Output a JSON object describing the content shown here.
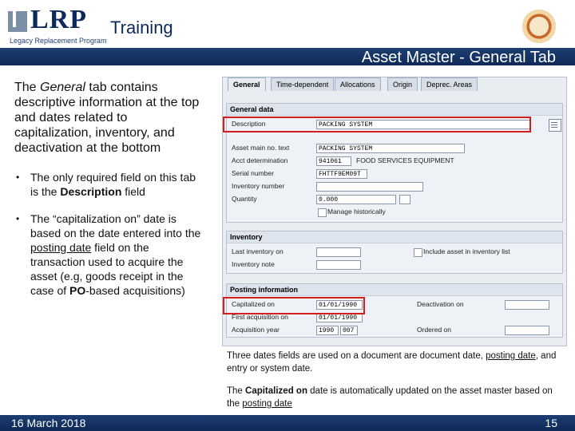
{
  "header": {
    "logo": "LRP",
    "logo_sub": "Legacy Replacement Program",
    "brand_title": "Training",
    "slide_title": "Asset Master - General Tab"
  },
  "left": {
    "intro_prefix": "The ",
    "intro_emph": "General",
    "intro_rest": " tab contains descriptive information at the top and dates related to capitalization, inventory, and deactivation at the bottom",
    "bullet1_prefix": "The only required field on this tab is the ",
    "bullet1_bold": "Description",
    "bullet1_suffix": " field",
    "bullet2_a": "The “capitalization on” date is based on the date entered into the ",
    "bullet2_link": "posting date",
    "bullet2_b": " field on the transaction used to acquire the asset (e.g, goods receipt in the case of ",
    "bullet2_bold": "PO",
    "bullet2_c": "-based acquisitions)"
  },
  "sap": {
    "tabs": [
      "General",
      "Time-dependent",
      "Allocations",
      "Origin",
      "Deprec. Areas"
    ],
    "general_data": {
      "title": "General data",
      "description_label": "Description",
      "description_value": "PACKING SYSTEM",
      "main_no_label": "Asset main no. text",
      "main_no_value": "PACKING SYSTEM",
      "acct_label": "Acct determination",
      "acct_value": "941061",
      "acct_text": "FOOD SERVICES EQUIPMENT",
      "serial_label": "Serial number",
      "serial_value": "FHTTF9EM09T",
      "inventory_number_label": "Inventory number",
      "quantity_label": "Quantity",
      "quantity_value": "0.000",
      "manage_hist_label": "Manage historically"
    },
    "inventory": {
      "title": "Inventory",
      "last_inv_label": "Last inventory on",
      "include_label": "Include asset in inventory list",
      "note_label": "Inventory note"
    },
    "posting": {
      "title": "Posting information",
      "cap_label": "Capitalized on",
      "cap_value": "01/01/1990",
      "first_acq_label": "First acquisition on",
      "first_acq_value": "01/01/1990",
      "acq_year_label": "Acquisition year",
      "acq_year_value": "1990",
      "acq_period_value": "007",
      "deact_label": "Deactivation on",
      "ordered_label": "Ordered on"
    }
  },
  "caption1": {
    "a": "Three dates fields are used on a document are document date, ",
    "link": "posting date",
    "b": ", and entry or system date."
  },
  "caption2": {
    "a": "The ",
    "bold": "Capitalized on",
    "b": " date is automatically updated on the asset master based on the ",
    "link": "posting date"
  },
  "footer": {
    "date": "16 March 2018",
    "page": "15"
  }
}
